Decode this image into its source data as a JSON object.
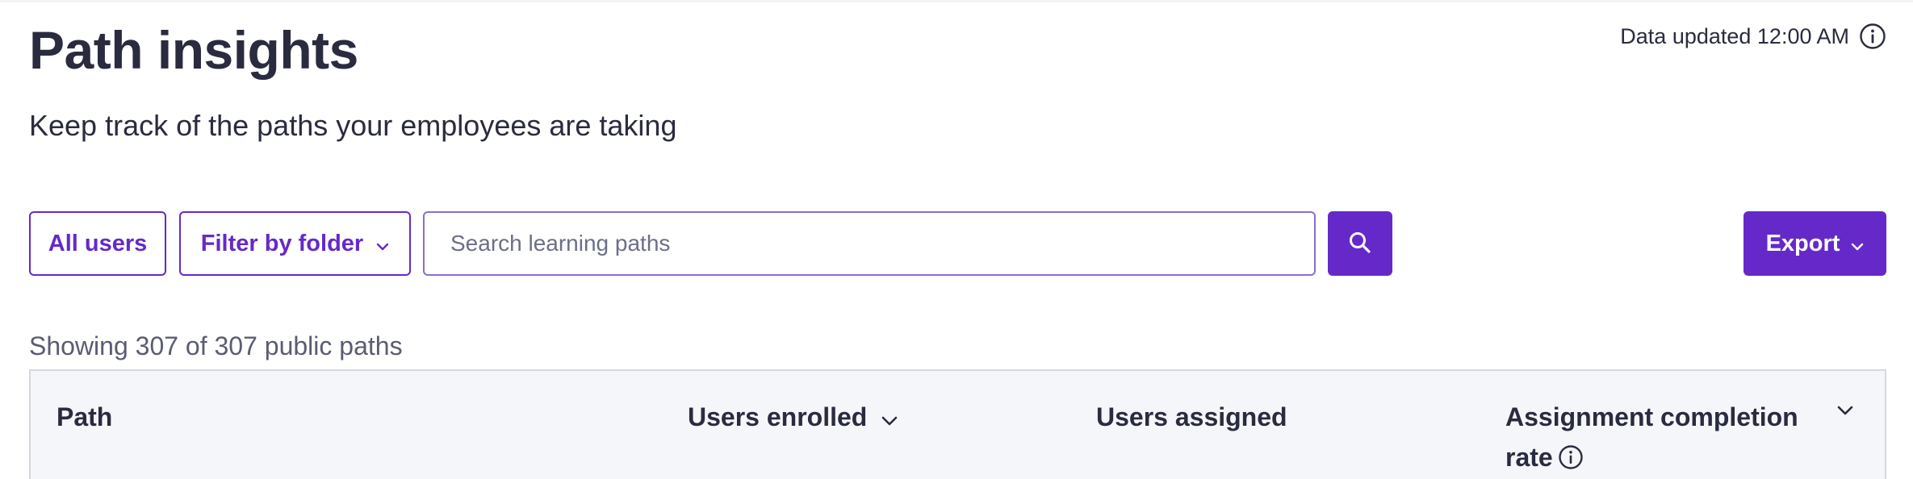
{
  "header": {
    "title": "Path insights",
    "subtitle": "Keep track of the paths your employees are taking",
    "updated_text": "Data updated 12:00 AM"
  },
  "toolbar": {
    "all_users_label": "All users",
    "filter_folder_label": "Filter by folder",
    "search_placeholder": "Search learning paths",
    "search_value": "",
    "export_label": "Export"
  },
  "summary": {
    "showing_text": "Showing 307 of 307 public paths"
  },
  "table": {
    "columns": [
      {
        "label": "Path",
        "sortable": false
      },
      {
        "label": "Users enrolled",
        "sortable": true
      },
      {
        "label": "Users assigned",
        "sortable": false
      },
      {
        "label": "Assignment completion",
        "label_line2": "rate",
        "sortable": true,
        "has_info": true
      }
    ]
  },
  "icons": {
    "info": "info-icon",
    "search": "search-icon",
    "chevron": "chevron-down-icon"
  },
  "colors": {
    "accent": "#6529c9",
    "text": "#2a2b3f",
    "muted": "#5a5c72",
    "table_header_bg": "#f5f6f9",
    "border": "#d6d7e0"
  }
}
